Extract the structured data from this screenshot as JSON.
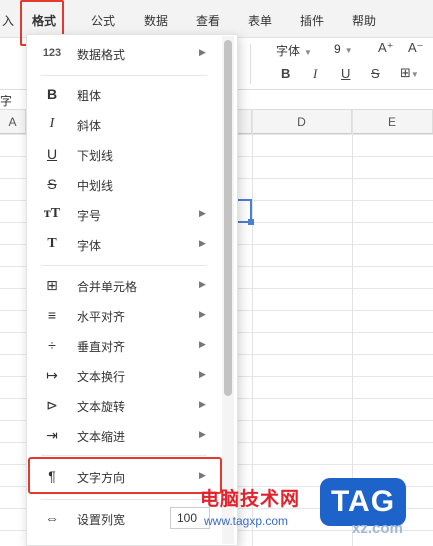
{
  "menubar": {
    "items": [
      "入",
      "格式",
      "公式",
      "数据",
      "查看",
      "表单",
      "插件",
      "帮助"
    ],
    "active": "格式"
  },
  "toolbar": {
    "font_name": "字体",
    "font_size": "9",
    "increase_font": "A⁺",
    "decrease_font": "A⁻",
    "bold": "B",
    "italic": "I",
    "underline": "U",
    "strikethrough": "S",
    "left_partial": "字"
  },
  "columns": [
    "A",
    "D",
    "E"
  ],
  "menu": {
    "items": [
      {
        "icon": "number-format-icon",
        "glyph": "123",
        "label": "数据格式",
        "submenu": true
      },
      {
        "icon": "bold-icon",
        "glyph": "B",
        "label": "粗体",
        "submenu": false
      },
      {
        "icon": "italic-icon",
        "glyph": "I",
        "label": "斜体",
        "submenu": false
      },
      {
        "icon": "underline-icon",
        "glyph": "U",
        "label": "下划线",
        "submenu": false
      },
      {
        "icon": "strikethrough-icon",
        "glyph": "S",
        "label": "中划线",
        "submenu": false
      },
      {
        "icon": "font-size-icon",
        "glyph": "тT",
        "label": "字号",
        "submenu": true
      },
      {
        "icon": "font-icon",
        "glyph": "T",
        "label": "字体",
        "submenu": true
      },
      {
        "icon": "merge-cells-icon",
        "glyph": "⊞",
        "label": "合并单元格",
        "submenu": true
      },
      {
        "icon": "horizontal-align-icon",
        "glyph": "≡",
        "label": "水平对齐",
        "submenu": true
      },
      {
        "icon": "vertical-align-icon",
        "glyph": "÷",
        "label": "垂直对齐",
        "submenu": true
      },
      {
        "icon": "text-wrap-icon",
        "glyph": "↦",
        "label": "文本换行",
        "submenu": true
      },
      {
        "icon": "text-rotate-icon",
        "glyph": "⊳",
        "label": "文本旋转",
        "submenu": true
      },
      {
        "icon": "text-indent-icon",
        "glyph": "⇥",
        "label": "文本缩进",
        "submenu": true
      },
      {
        "icon": "text-direction-icon",
        "glyph": "¶",
        "label": "文字方向",
        "submenu": true
      },
      {
        "icon": "column-width-icon",
        "glyph": "⇔",
        "label": "设置列宽",
        "submenu": false
      }
    ],
    "column_width_value": "100"
  },
  "watermark": {
    "site_name": "电脑技术网",
    "url": "www.tagxp.com",
    "tag": "TAG",
    "xz": "xz.com"
  },
  "colors": {
    "highlight_red": "#e23a2e",
    "selection_blue": "#4a7fd6",
    "tag_blue": "#1e63c9"
  }
}
